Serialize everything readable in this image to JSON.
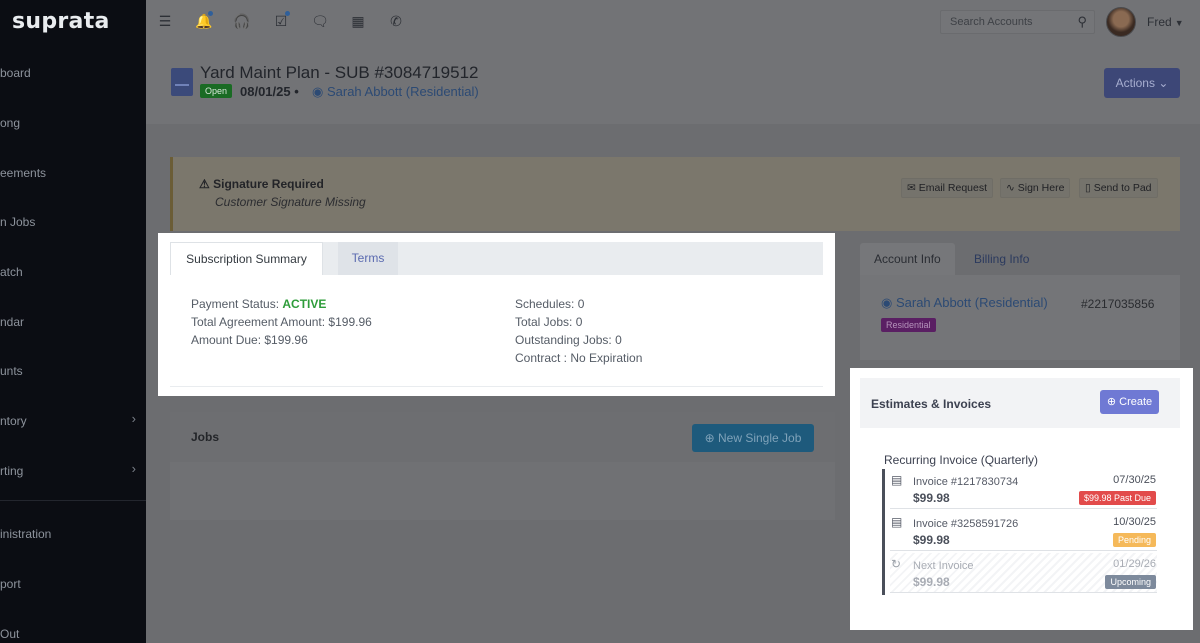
{
  "sidebar": {
    "brand": "suprata",
    "items": [
      {
        "label": "board",
        "chevron": false
      },
      {
        "label": "ong",
        "chevron": false
      },
      {
        "label": "eements",
        "chevron": false
      },
      {
        "label": "n Jobs",
        "chevron": false
      },
      {
        "label": "atch",
        "chevron": false
      },
      {
        "label": "ndar",
        "chevron": false
      },
      {
        "label": "unts",
        "chevron": false
      },
      {
        "label": "ntory",
        "chevron": true
      },
      {
        "label": "rting",
        "chevron": true
      },
      {
        "label": "inistration",
        "chevron": false
      },
      {
        "label": "port",
        "chevron": false
      },
      {
        "label": "Out",
        "chevron": false
      }
    ]
  },
  "topbar": {
    "icons": [
      "menu-icon",
      "bell-icon",
      "headset-icon",
      "task-icon",
      "chat-icon",
      "calculator-icon",
      "phone-icon"
    ],
    "search_placeholder": "Search Accounts",
    "user_name": "Fred"
  },
  "header": {
    "title": "Yard Maint Plan - SUB #3084719512",
    "status": "Open",
    "date": "08/01/25",
    "separator": "•",
    "account_link": "Sarah Abbott (Residential)",
    "actions_label": "Actions"
  },
  "alert": {
    "title": "Signature Required",
    "subtitle": "Customer Signature Missing",
    "buttons": [
      "Email Request",
      "Sign Here",
      "Send to Pad"
    ]
  },
  "subscription": {
    "tabs": [
      "Subscription Summary",
      "Terms"
    ],
    "left": [
      {
        "label": "Payment Status: ",
        "value": "ACTIVE"
      },
      {
        "label": "Total Agreement Amount: ",
        "value": "$199.96"
      },
      {
        "label": "Amount Due: ",
        "value": "$199.96"
      }
    ],
    "right": [
      {
        "label": "Schedules: ",
        "value": "0"
      },
      {
        "label": "Total Jobs: ",
        "value": "0"
      },
      {
        "label": "Outstanding Jobs: ",
        "value": "0"
      },
      {
        "label": "Contract : ",
        "value": "No Expiration"
      }
    ]
  },
  "jobs": {
    "title": "Jobs",
    "new_button": "New Single Job"
  },
  "account_panel": {
    "tabs": [
      "Account Info",
      "Billing Info"
    ],
    "name": "Sarah Abbott (Residential)",
    "number": "#2217035856",
    "badge": "Residential"
  },
  "estimates": {
    "title": "Estimates & Invoices",
    "create_label": "Create",
    "recurring_title": "Recurring Invoice (Quarterly)",
    "invoices": [
      {
        "label": "Invoice #1217830734",
        "amount": "$99.98",
        "date": "07/30/25",
        "badge": "$99.98 Past Due",
        "badge_color": "#e24b4b",
        "next": false
      },
      {
        "label": "Invoice #3258591726",
        "amount": "$99.98",
        "date": "10/30/25",
        "badge": "Pending",
        "badge_color": "#f5b95a",
        "next": false
      },
      {
        "label": "Next Invoice",
        "amount": "$99.98",
        "date": "01/29/26",
        "badge": "Upcoming",
        "badge_color": "#7d8a9c",
        "next": true
      }
    ]
  },
  "colors": {
    "active_status": "#2e9c3a",
    "create_button": "#6f79d4",
    "link_blue": "#2c4a74"
  }
}
